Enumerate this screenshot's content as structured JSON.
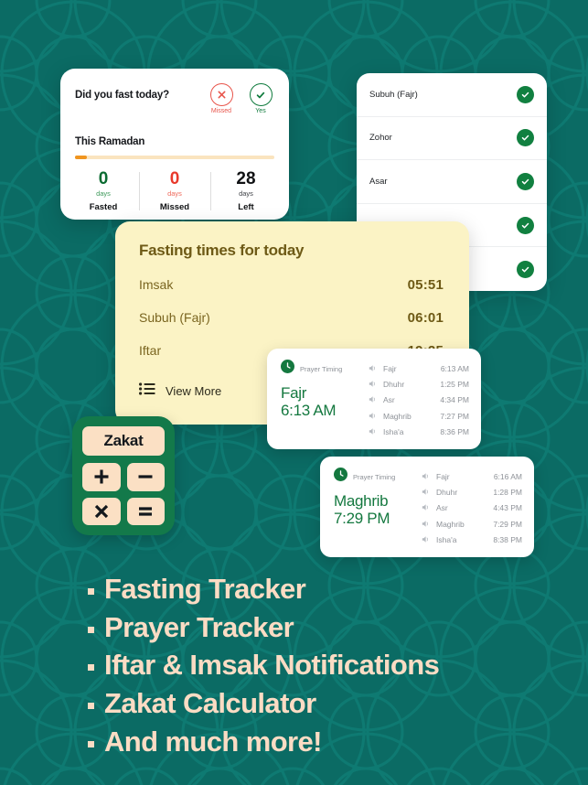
{
  "theme": {
    "background": "#0b6b64",
    "card_white": "#ffffff",
    "card_yellow": "#fbf3c5",
    "accent_green": "#118040",
    "accent_red": "#e8544a",
    "accent_orange": "#f0951f",
    "cream_text": "#fbdcc4",
    "gold_text": "#6e5a16"
  },
  "fasting_tracker": {
    "question": "Did you fast today?",
    "answers": [
      {
        "icon": "cross-icon",
        "label": "Missed",
        "state": "missed"
      },
      {
        "icon": "check-icon",
        "label": "Yes",
        "state": "yes"
      }
    ],
    "section_title": "This Ramadan",
    "progress_percent": 6,
    "stats": [
      {
        "value": "0",
        "unit": "days",
        "label": "Fasted",
        "tone": "green"
      },
      {
        "value": "0",
        "unit": "days",
        "label": "Missed",
        "tone": "red"
      },
      {
        "value": "28",
        "unit": "days",
        "label": "Left",
        "tone": "dark"
      }
    ]
  },
  "prayer_checklist": {
    "rows": [
      {
        "name": "Subuh (Fajr)",
        "checked": true
      },
      {
        "name": "Zohor",
        "checked": true
      },
      {
        "name": "Asar",
        "checked": true
      },
      {
        "name": "",
        "checked": true
      },
      {
        "name": "",
        "checked": true
      }
    ]
  },
  "fasting_times": {
    "title": "Fasting times for today",
    "rows": [
      {
        "label": "Imsak",
        "time": "05:51"
      },
      {
        "label": "Subuh (Fajr)",
        "time": "06:01"
      },
      {
        "label": "Iftar",
        "time": "19:25"
      }
    ],
    "more_label": "View More",
    "more_icon": "list-icon"
  },
  "widgets": [
    {
      "brand_label": "Prayer Timing",
      "brand_icon": "clock-icon",
      "next_name": "Fajr",
      "next_time": "6:13 AM",
      "rows": [
        {
          "icon": "speaker-icon",
          "name": "Fajr",
          "time": "6:13 AM"
        },
        {
          "icon": "speaker-icon",
          "name": "Dhuhr",
          "time": "1:25 PM"
        },
        {
          "icon": "speaker-icon",
          "name": "Asr",
          "time": "4:34 PM"
        },
        {
          "icon": "speaker-icon",
          "name": "Maghrib",
          "time": "7:27 PM"
        },
        {
          "icon": "speaker-icon",
          "name": "Isha'a",
          "time": "8:36 PM"
        }
      ]
    },
    {
      "brand_label": "Prayer Timing",
      "brand_icon": "clock-icon",
      "next_name": "Maghrib",
      "next_time": "7:29 PM",
      "rows": [
        {
          "icon": "speaker-icon",
          "name": "Fajr",
          "time": "6:16 AM"
        },
        {
          "icon": "speaker-icon",
          "name": "Dhuhr",
          "time": "1:28 PM"
        },
        {
          "icon": "speaker-icon",
          "name": "Asr",
          "time": "4:43 PM"
        },
        {
          "icon": "speaker-icon",
          "name": "Maghrib",
          "time": "7:29 PM"
        },
        {
          "icon": "speaker-icon",
          "name": "Isha'a",
          "time": "8:38 PM"
        }
      ]
    }
  ],
  "zakat_icon": {
    "screen_text": "Zakat",
    "keys": [
      "plus-icon",
      "minus-icon",
      "multiply-icon",
      "equals-icon"
    ]
  },
  "features": [
    "Fasting Tracker",
    "Prayer Tracker",
    "Iftar & Imsak Notifications",
    "Zakat Calculator",
    "And much more!"
  ]
}
